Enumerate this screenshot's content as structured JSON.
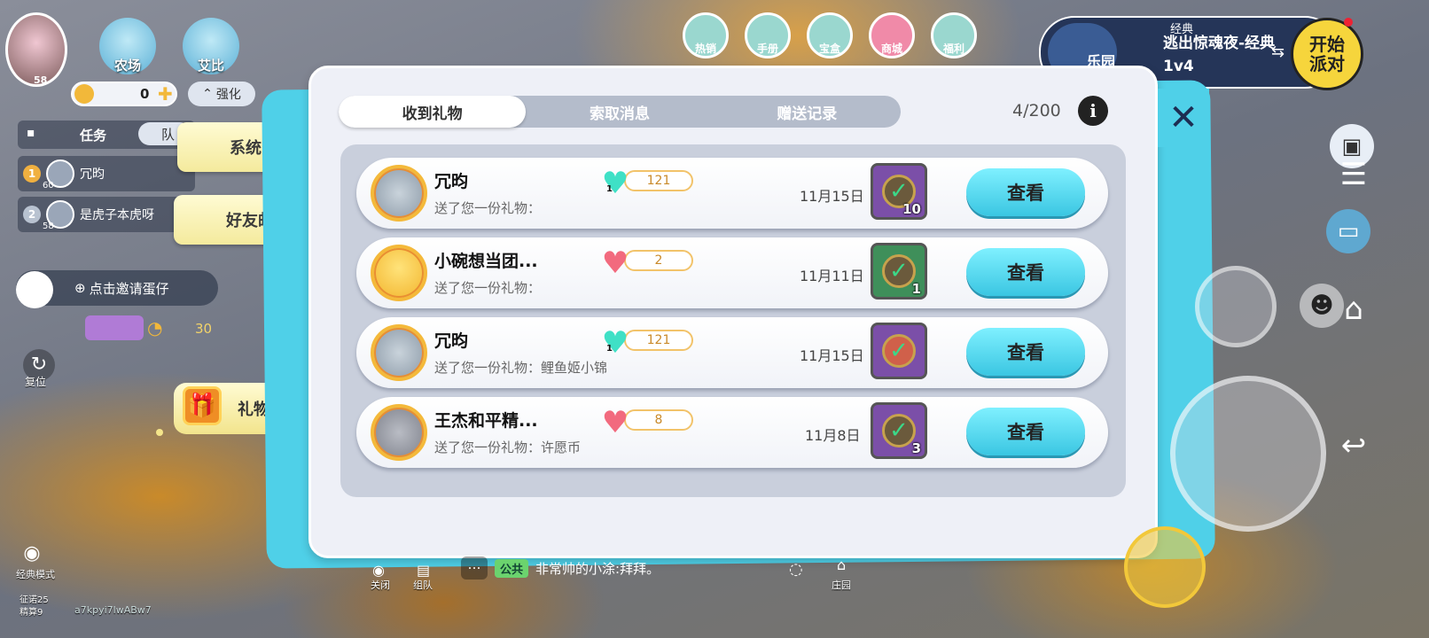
{
  "hud": {
    "player_level": "58",
    "farm_label": "农场",
    "aibi_label": "艾比",
    "coins": "0",
    "enhance_label": "强化",
    "task_tab": "任务",
    "team_tab": "队",
    "rank_rows": [
      {
        "rank": "1",
        "level": "60",
        "name": "冗昀"
      },
      {
        "rank": "2",
        "level": "58",
        "name": "是虎子本虎呀"
      }
    ],
    "invite_label": "点击邀请蛋仔",
    "currency_count": "30",
    "reset_label": "复位",
    "classic_mode_label": "经典模式",
    "top_tags": [
      "热销",
      "手册",
      "宝盒",
      "商城",
      "福利"
    ],
    "stat1": "征诺25",
    "stat2": "精算9",
    "user_code": "a7kpyi7lwABw7",
    "mute_label": "关闭",
    "team_label": "组队",
    "chat_channel": "公共",
    "chat_message": "非常帅的小涂:拜拜。",
    "home_label": "庄园"
  },
  "mail_tabs": {
    "system": "系统邮件",
    "friend": "好友邮件",
    "gift_center": "礼物中心"
  },
  "mode": {
    "tag": "经典",
    "name": "逃出惊魂夜-经典1v4",
    "paradise": "乐园",
    "start_label": "开始派对"
  },
  "panel": {
    "tabs": [
      "收到礼物",
      "索取消息",
      "赠送记录"
    ],
    "active_tab": 0,
    "count": "4/200",
    "info_icon": "i",
    "close_icon": "✕"
  },
  "gifts": [
    {
      "name": "冗昀",
      "message": "送了您一份礼物：",
      "heart_color": "#3fe0c6",
      "heart_level": "1",
      "intimacy": "121",
      "date": "11月15日",
      "item_count": "10",
      "box_color": "#7b4fa8",
      "button": "查看"
    },
    {
      "name": "小碗想当团...",
      "message": "送了您一份礼物：",
      "heart_color": "#f26a7e",
      "heart_level": "",
      "intimacy": "2",
      "date": "11月11日",
      "item_count": "1",
      "box_color": "#3f8f5a",
      "button": "查看"
    },
    {
      "name": "冗昀",
      "message": "送了您一份礼物：鲤鱼姬小锦",
      "heart_color": "#3fe0c6",
      "heart_level": "1",
      "intimacy": "121",
      "date": "11月15日",
      "item_count": "",
      "box_color": "#7b4fa8",
      "button": "查看"
    },
    {
      "name": "王杰和平精...",
      "message": "送了您一份礼物：许愿币",
      "heart_color": "#f26a7e",
      "heart_level": "",
      "intimacy": "8",
      "date": "11月8日",
      "item_count": "3",
      "box_color": "#7b4fa8",
      "button": "查看"
    }
  ]
}
